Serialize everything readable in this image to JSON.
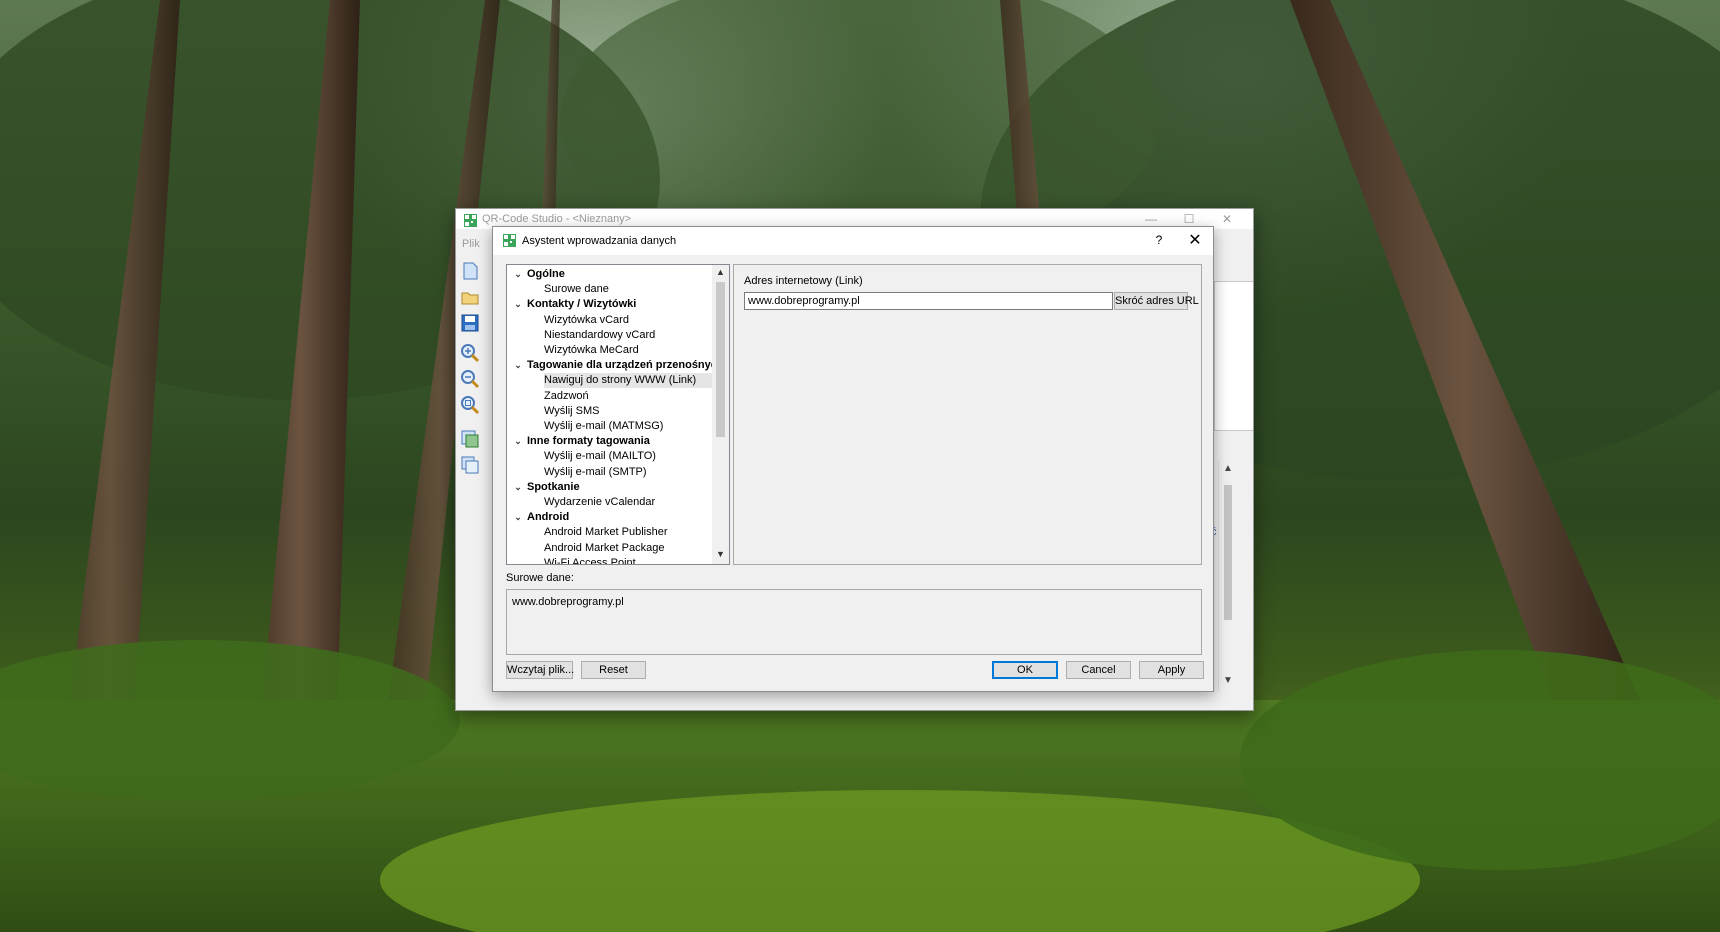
{
  "app": {
    "title": "QR-Code Studio - <Nieznany>",
    "menu_file": "Plik",
    "window_controls": {
      "minimize": "—",
      "maximize": "☐",
      "close": "✕"
    },
    "side_text_1": "ć",
    "side_text_2": "l",
    "toolbar_icons": [
      "new-document-icon",
      "open-folder-icon",
      "save-icon",
      "zoom-in-icon",
      "zoom-out-icon",
      "zoom-fit-icon",
      "export-image-icon",
      "copy-image-icon"
    ]
  },
  "dialog": {
    "title": "Asystent wprowadzania danych",
    "help": "?",
    "close": "✕",
    "tree": [
      {
        "label": "Ogólne",
        "category": true
      },
      {
        "label": "Surowe dane",
        "category": false
      },
      {
        "label": "Kontakty / Wizytówki",
        "category": true
      },
      {
        "label": "Wizytówka vCard",
        "category": false
      },
      {
        "label": "Niestandardowy vCard",
        "category": false
      },
      {
        "label": "Wizytówka MeCard",
        "category": false
      },
      {
        "label": "Tagowanie dla urządzeń przenośnych",
        "category": true
      },
      {
        "label": "Nawiguj do strony WWW (Link)",
        "category": false,
        "selected": true
      },
      {
        "label": "Zadzwoń",
        "category": false
      },
      {
        "label": "Wyślij SMS",
        "category": false
      },
      {
        "label": "Wyślij e-mail (MATMSG)",
        "category": false
      },
      {
        "label": "Inne formaty tagowania",
        "category": true
      },
      {
        "label": "Wyślij e-mail (MAILTO)",
        "category": false
      },
      {
        "label": "Wyślij e-mail (SMTP)",
        "category": false
      },
      {
        "label": "Spotkanie",
        "category": true
      },
      {
        "label": "Wydarzenie vCalendar",
        "category": false
      },
      {
        "label": "Android",
        "category": true
      },
      {
        "label": "Android Market Publisher",
        "category": false
      },
      {
        "label": "Android Market Package",
        "category": false
      },
      {
        "label": "Wi-Fi Access Point",
        "category": false
      }
    ],
    "url_label": "Adres internetowy (Link)",
    "url_value": "www.dobreprogramy.pl",
    "shorten_button": "Skróć adres URL",
    "raw_label": "Surowe dane:",
    "raw_value": "www.dobreprogramy.pl",
    "buttons": {
      "load_file": "Wczytaj plik...",
      "reset": "Reset",
      "ok": "OK",
      "cancel": "Cancel",
      "apply": "Apply"
    }
  },
  "colors": {
    "accent": "#0078d7",
    "dialog_bg": "#f0f0f0",
    "selection": "#e5e5e5",
    "qr_icon": "#3ba55c"
  }
}
